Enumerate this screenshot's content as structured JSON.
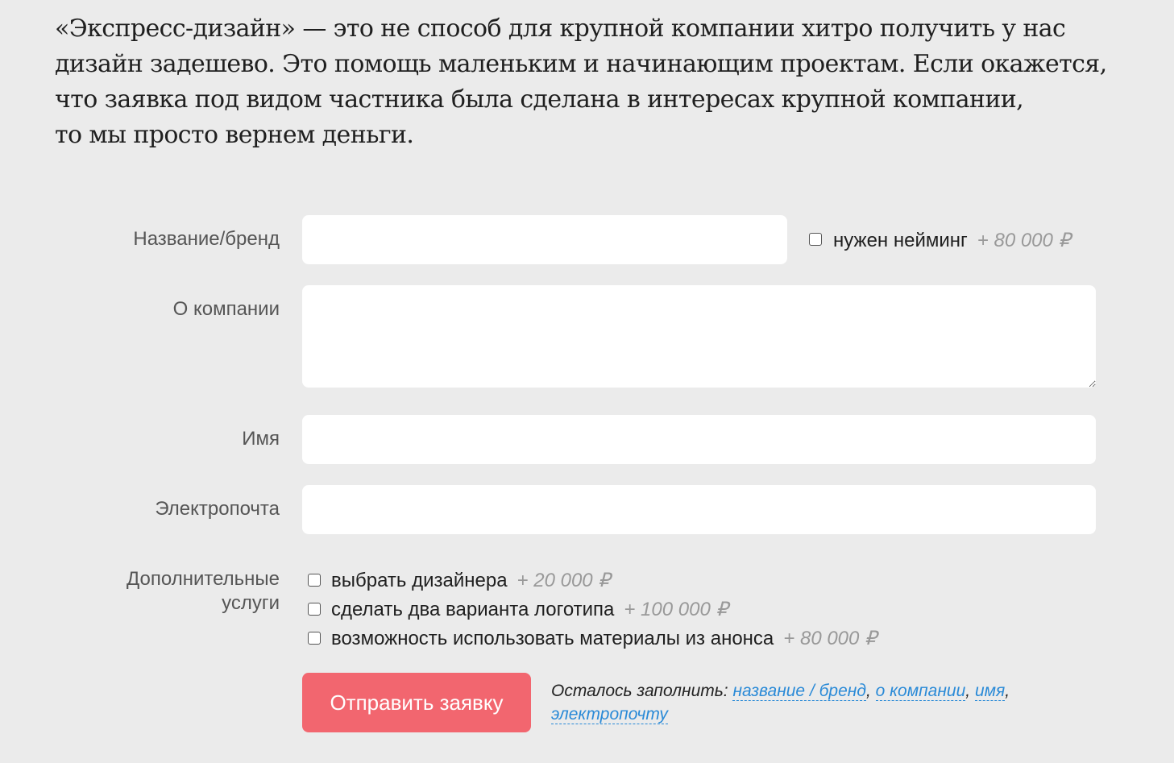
{
  "intro": {
    "line1": "«Экспресс-дизайн» — это не способ для крупной компании хитро получить у нас",
    "line2": "дизайн задешево. Это помощь маленьким и начинающим проектам. Если окажется,",
    "line3": "что заявка под видом частника была сделана в интересах крупной компании,",
    "line4": "то мы просто вернем деньги."
  },
  "form": {
    "brand_label": "Название/бренд",
    "brand_value": "",
    "naming_label": "нужен нейминг",
    "naming_price": "+ 80 000 ₽",
    "about_label": "О компании",
    "about_value": "",
    "name_label": "Имя",
    "name_value": "",
    "email_label": "Электропочта",
    "email_value": "",
    "extra_label_line1": "Дополнительные",
    "extra_label_line2": "услуги",
    "extras": [
      {
        "label": "выбрать дизайнера",
        "price": "+ 20 000 ₽"
      },
      {
        "label": "сделать два варианта логотипа",
        "price": "+ 100 000 ₽"
      },
      {
        "label": "возможность использовать материалы из анонса",
        "price": "+ 80 000 ₽"
      }
    ],
    "submit_label": "Отправить заявку",
    "remaining_prefix": "Осталось заполнить:",
    "remaining_links": [
      "название / бренд",
      "о компании",
      "имя",
      "электропочту"
    ]
  }
}
